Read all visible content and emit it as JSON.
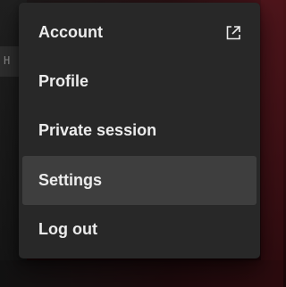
{
  "background": {
    "partial_label": "H I"
  },
  "menu": {
    "items": [
      {
        "label": "Account",
        "icon": "external-link-icon"
      },
      {
        "label": "Profile"
      },
      {
        "label": "Private session"
      },
      {
        "label": "Settings",
        "highlighted": true
      },
      {
        "label": "Log out"
      }
    ]
  },
  "colors": {
    "menu_bg": "#282828",
    "highlight_bg": "#3e3e3e",
    "text": "#ececec"
  }
}
